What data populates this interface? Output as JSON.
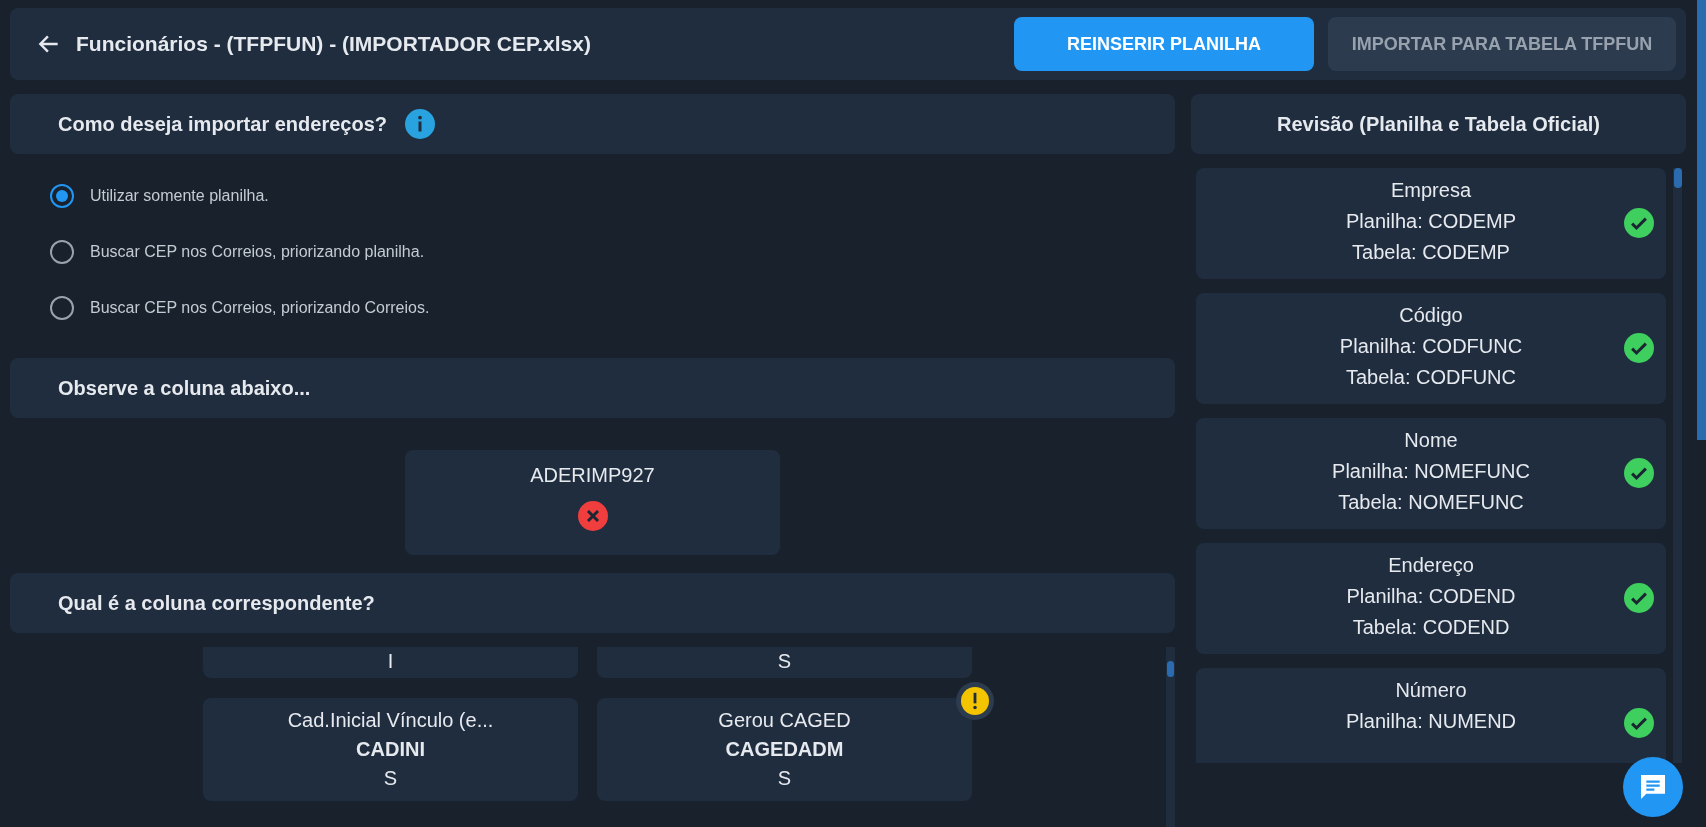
{
  "header": {
    "title": "Funcionários - (TFPFUN) - (IMPORTADOR CEP.xlsx)",
    "buttons": [
      {
        "label": "REINSERIR PLANILHA",
        "disabled": false
      },
      {
        "label": "IMPORTAR PARA TABELA TFPFUN",
        "disabled": true
      }
    ]
  },
  "address_section": {
    "title": "Como deseja importar endereços?",
    "options": [
      {
        "label": "Utilizar somente planilha.",
        "selected": true
      },
      {
        "label": "Buscar CEP nos Correios, priorizando planilha.",
        "selected": false
      },
      {
        "label": "Buscar CEP nos Correios, priorizando Correios.",
        "selected": false
      }
    ]
  },
  "observe_section": {
    "title": "Observe a coluna abaixo...",
    "column": {
      "name": "ADERIMP927",
      "valid": false
    }
  },
  "match_section": {
    "title": "Qual é a coluna correspondente?",
    "cards": [
      {
        "value": "I",
        "warning": false
      },
      {
        "value": "S",
        "warning": false
      },
      {
        "label": "Cad.Inicial Vínculo (e...",
        "code": "CADINI",
        "value": "S",
        "warning": false
      },
      {
        "label": "Gerou CAGED",
        "code": "CAGEDADM",
        "value": "S",
        "warning": true
      }
    ]
  },
  "review": {
    "title": "Revisão (Planilha e Tabela Oficial)",
    "items": [
      {
        "name": "Empresa",
        "sheet": "Planilha: CODEMP",
        "table": "Tabela: CODEMP",
        "valid": true
      },
      {
        "name": "Código",
        "sheet": "Planilha: CODFUNC",
        "table": "Tabela: CODFUNC",
        "valid": true
      },
      {
        "name": "Nome",
        "sheet": "Planilha: NOMEFUNC",
        "table": "Tabela: NOMEFUNC",
        "valid": true
      },
      {
        "name": "Endereço",
        "sheet": "Planilha: CODEND",
        "table": "Tabela: CODEND",
        "valid": true
      },
      {
        "name": "Número",
        "sheet": "Planilha: NUMEND",
        "valid": true
      }
    ]
  }
}
